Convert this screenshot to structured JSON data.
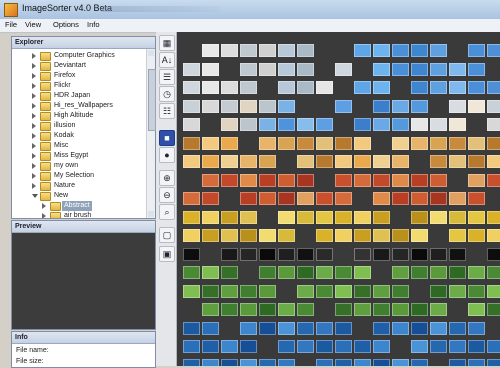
{
  "window": {
    "title": "ImageSorter v4.0 Beta"
  },
  "menu": [
    "File",
    "View",
    "Options",
    "Info"
  ],
  "explorer": {
    "title": "Explorer",
    "items": [
      {
        "label": "Computer Graphics",
        "level": 0,
        "expanded": false,
        "selected": false
      },
      {
        "label": "Deviantart",
        "level": 0,
        "expanded": false,
        "selected": false
      },
      {
        "label": "Firefox",
        "level": 0,
        "expanded": false,
        "selected": false
      },
      {
        "label": "Flickr",
        "level": 0,
        "expanded": false,
        "selected": false
      },
      {
        "label": "HDR Japan",
        "level": 0,
        "expanded": false,
        "selected": false
      },
      {
        "label": "Hi_res_Wallpapers",
        "level": 0,
        "expanded": false,
        "selected": false
      },
      {
        "label": "High Altitude",
        "level": 0,
        "expanded": false,
        "selected": false
      },
      {
        "label": "illusion",
        "level": 0,
        "expanded": false,
        "selected": false
      },
      {
        "label": "Kodak",
        "level": 0,
        "expanded": false,
        "selected": false
      },
      {
        "label": "Misc",
        "level": 0,
        "expanded": false,
        "selected": false
      },
      {
        "label": "Miss Egypt",
        "level": 0,
        "expanded": false,
        "selected": false
      },
      {
        "label": "my own",
        "level": 0,
        "expanded": false,
        "selected": false
      },
      {
        "label": "My Selection",
        "level": 0,
        "expanded": false,
        "selected": false
      },
      {
        "label": "Nature",
        "level": 0,
        "expanded": false,
        "selected": false
      },
      {
        "label": "New",
        "level": 0,
        "expanded": true,
        "selected": false
      },
      {
        "label": "Abstract",
        "level": 1,
        "expanded": false,
        "selected": true
      },
      {
        "label": "air brush",
        "level": 1,
        "expanded": false,
        "selected": false
      }
    ]
  },
  "preview": {
    "title": "Preview"
  },
  "info": {
    "title": "Info",
    "file_name_label": "File name:",
    "file_size_label": "File size:"
  },
  "toolbar": [
    {
      "name": "color-sort-icon",
      "glyph": "▦",
      "active": false
    },
    {
      "name": "alpha-sort-icon",
      "glyph": "A↓",
      "active": false
    },
    {
      "name": "size-sort-icon",
      "glyph": "☰",
      "active": false
    },
    {
      "name": "date-sort-icon",
      "glyph": "◷",
      "active": false
    },
    {
      "name": "similarity-icon",
      "glyph": "☷",
      "active": false
    },
    {
      "name": "grid-view-icon",
      "glyph": "■",
      "active": true
    },
    {
      "name": "sphere-view-icon",
      "glyph": "●",
      "active": false
    },
    {
      "name": "zoom-in-icon",
      "glyph": "⊕",
      "active": false
    },
    {
      "name": "zoom-out-icon",
      "glyph": "⊖",
      "active": false
    },
    {
      "name": "search-icon",
      "glyph": "⌕",
      "active": false
    },
    {
      "name": "fit-screen-icon",
      "glyph": "▢",
      "active": false
    },
    {
      "name": "fullscreen-icon",
      "glyph": "▣",
      "active": false
    }
  ],
  "colors": {
    "gallery_bg": "#3a3a3a",
    "selected_row": "#8fa2b9",
    "folder": "#e2b740"
  },
  "gallery": {
    "thumbnail_colors": [
      "#cfd6de",
      "#e8e8e8",
      "#dcdcdc",
      "#bfc7cf",
      "#cfcfcf",
      "#b7c9d8",
      "#a9b9c6",
      "#e6e6e6",
      "#4f8fd6",
      "#5fa6e8",
      "#6db3ee",
      "#4a90d9",
      "#3f86d1",
      "#5fa0e0",
      "#7fb8ec",
      "#4b8fd8",
      "#e7e7e7",
      "#d9dde2",
      "#f0e7d8",
      "#c8d0d8",
      "#d8d8d8",
      "#c6cbd1",
      "#e0d5c0",
      "#bcc4cc",
      "#7ab2e6",
      "#4e93dc",
      "#86bdec",
      "#5d9fe2",
      "#9bc7f0",
      "#3b7fcc",
      "#6aa9e6",
      "#5599dd",
      "#f0d090",
      "#e7b46a",
      "#d8a452",
      "#c88a3c",
      "#e2c07a",
      "#b7792e",
      "#f2c97f",
      "#e9a94c",
      "#d56b3a",
      "#c24a2a",
      "#e08a4a",
      "#b83e24",
      "#cf5d32",
      "#a73520",
      "#e0a060",
      "#c9502c",
      "#e5c642",
      "#d9b22a",
      "#f0d060",
      "#c99f22",
      "#e0c050",
      "#b8901a",
      "#f2dc70",
      "#d7ba3a",
      "#1f1f1f",
      "#111111",
      "#2a2a2a",
      "#0d0d0d",
      "#333333",
      "#191919",
      "#262626",
      "#0a0a0a",
      "#3f7f2f",
      "#5a9a3a",
      "#2f6a24",
      "#6bab48",
      "#4b8a34",
      "#7fbf52",
      "#356f28",
      "#5f9f3f",
      "#2a6fb8",
      "#1f5fa8",
      "#3d85cc",
      "#174f96",
      "#4a93d6",
      "#2568b0",
      "#3377c0",
      "#1b5aa0"
    ]
  }
}
